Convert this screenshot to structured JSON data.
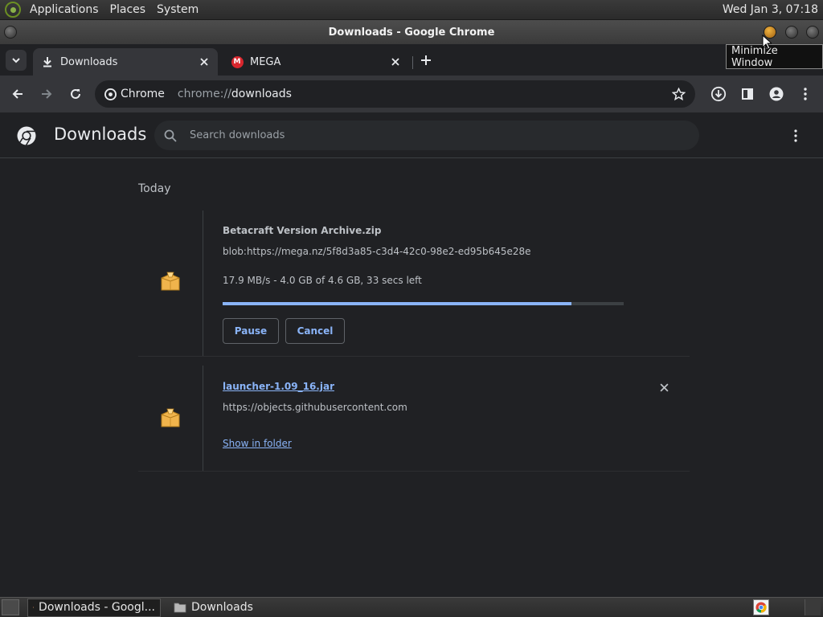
{
  "desktop": {
    "menus": [
      "Applications",
      "Places",
      "System"
    ],
    "clock": "Wed Jan  3, 07:18"
  },
  "window": {
    "title": "Downloads - Google Chrome",
    "tooltip": "Minimize Window"
  },
  "tabs": [
    {
      "label": "Downloads",
      "icon": "download-icon",
      "active": true
    },
    {
      "label": "MEGA",
      "icon": "mega-logo-icon",
      "active": false
    }
  ],
  "omnibox": {
    "chip_label": "Chrome",
    "url_scheme": "chrome://",
    "url_host": "downloads"
  },
  "page": {
    "title": "Downloads",
    "search_placeholder": "Search downloads",
    "date_group": "Today"
  },
  "downloads": [
    {
      "name": "Betacraft Version Archive.zip",
      "url": "blob:https://mega.nz/5f8d3a85-c3d4-42c0-98e2-ed95b645e28e",
      "status": "17.9 MB/s - 4.0 GB of 4.6 GB, 33 secs left",
      "progress_percent": 87,
      "pause_label": "Pause",
      "cancel_label": "Cancel"
    },
    {
      "name": "launcher-1.09_16.jar",
      "url": "https://objects.githubusercontent.com",
      "show_in_folder_label": "Show in folder"
    }
  ],
  "taskbar": {
    "items": [
      "Downloads - Googl...",
      "Downloads"
    ]
  },
  "colors": {
    "accent": "#8ab4f8",
    "background": "#202124",
    "toolbar": "#35363a"
  }
}
